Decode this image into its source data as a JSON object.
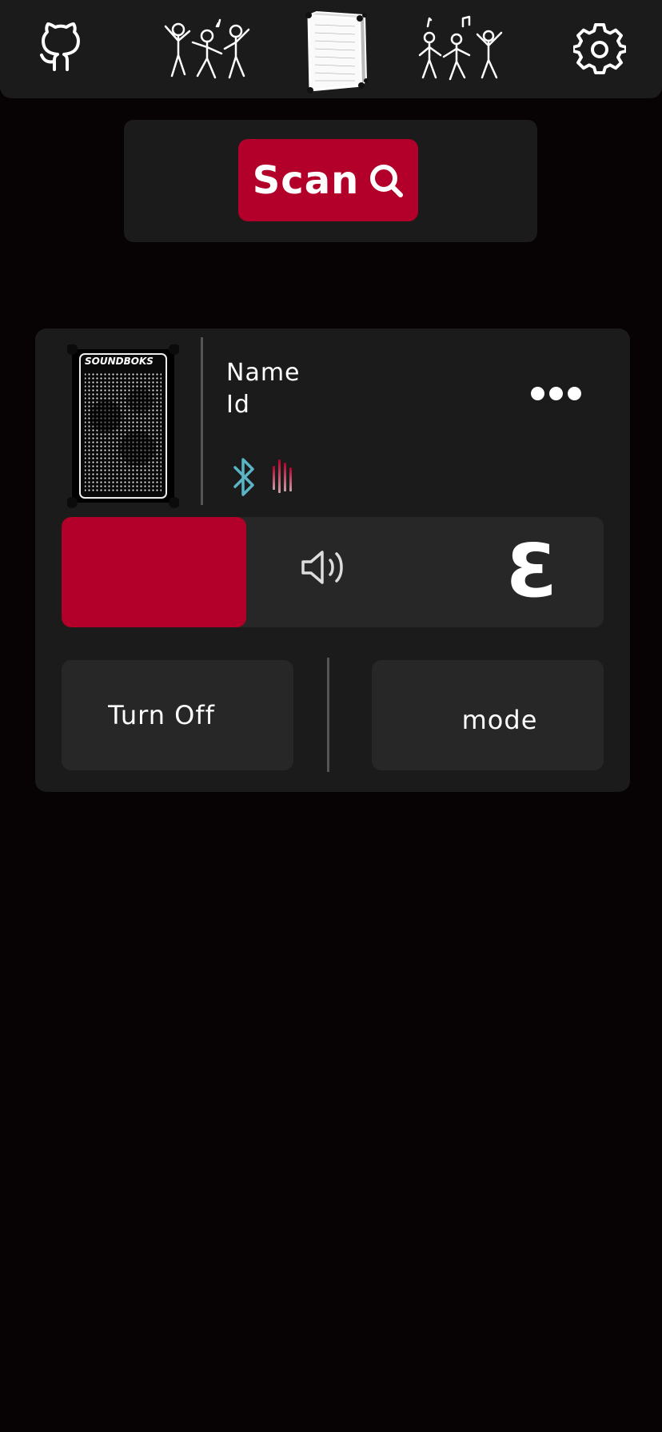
{
  "nav": {
    "items": [
      {
        "icon": "github-icon"
      },
      {
        "icon": "party-people-icon"
      },
      {
        "icon": "speaker-icon"
      },
      {
        "icon": "dancing-people-icon"
      },
      {
        "icon": "gear-icon"
      }
    ]
  },
  "scan": {
    "label": "Scan",
    "icon": "magnifier-icon"
  },
  "device": {
    "thumbnail_brand": "SOUNDBOKS",
    "name": "Name",
    "id": "Id",
    "connection_icon": "bluetooth-icon",
    "signal_icon": "audio-level-icon",
    "more_icon": "more-dots-icon"
  },
  "volume": {
    "value": "3",
    "level_fraction": 0.34,
    "icon": "speaker-volume-icon"
  },
  "actions": {
    "turn_off_label": "Turn Off",
    "mode_label": "mode"
  },
  "colors": {
    "background": "#070203",
    "panel": "#1b1b1b",
    "control": "#272727",
    "accent": "#b3002a",
    "bluetooth": "#5ab4c5"
  }
}
